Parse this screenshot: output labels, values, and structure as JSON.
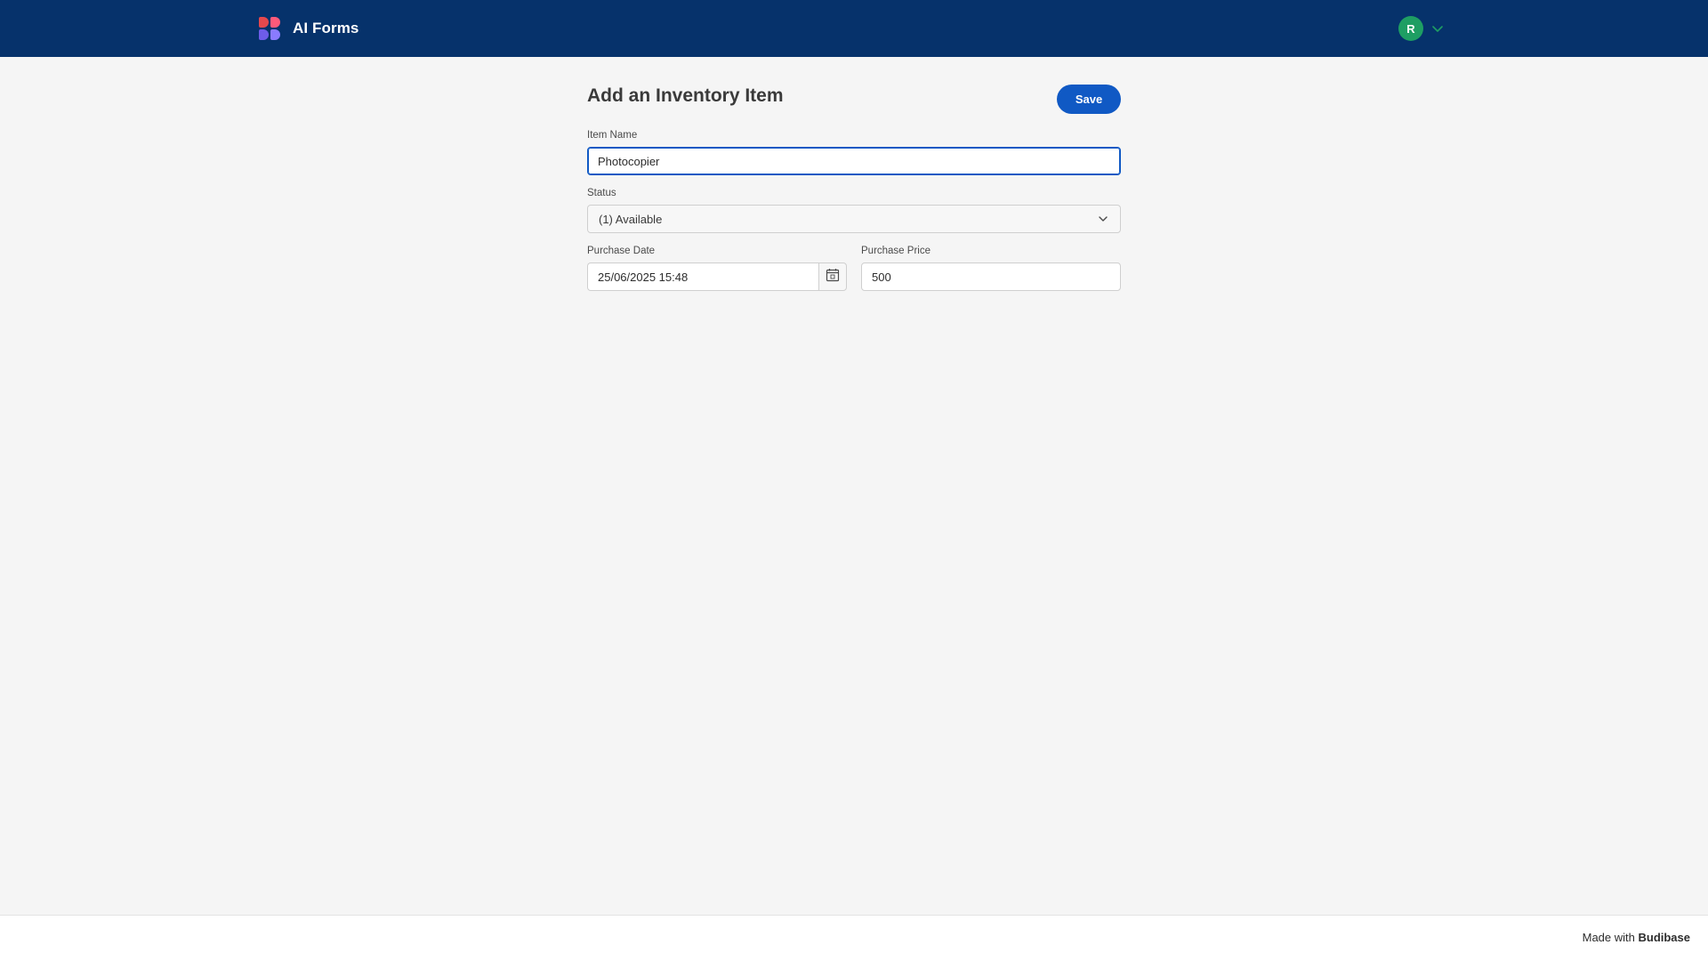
{
  "app": {
    "title": "AI Forms",
    "logo_icon": "budibase-logo-icon"
  },
  "user": {
    "avatar_initial": "R",
    "avatar_color": "#1e9e63",
    "menu_icon": "chevron-down-icon"
  },
  "colors": {
    "header_bg": "#06326b",
    "accent": "#1059c4",
    "page_bg": "#f5f5f5"
  },
  "page": {
    "title": "Add an Inventory Item",
    "save_label": "Save"
  },
  "form": {
    "item_name": {
      "label": "Item Name",
      "value": "Photocopier"
    },
    "status": {
      "label": "Status",
      "selected": "(1) Available",
      "icon": "chevron-down-icon"
    },
    "purchase_date": {
      "label": "Purchase Date",
      "value": "25/06/2025 15:48",
      "icon": "calendar-icon"
    },
    "purchase_price": {
      "label": "Purchase Price",
      "value": "500"
    }
  },
  "footer": {
    "made_with": "Made with",
    "brand": "Budibase"
  }
}
